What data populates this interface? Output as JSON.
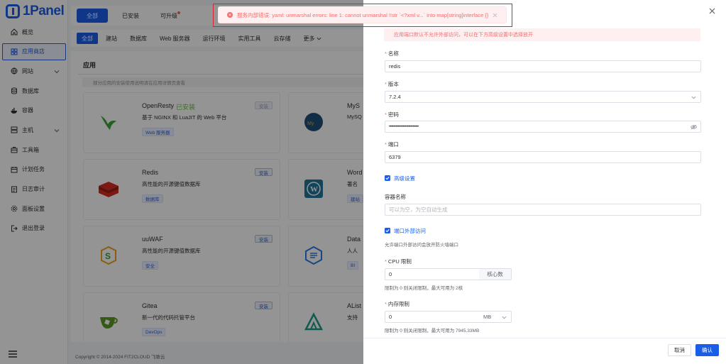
{
  "brand": {
    "name": "1Panel",
    "color": "#1a5ee8"
  },
  "sidebar": {
    "items": [
      {
        "label": "概览",
        "icon": "home-icon"
      },
      {
        "label": "应用商店",
        "icon": "grid-icon",
        "active": true
      },
      {
        "label": "网站",
        "icon": "globe-icon",
        "chevron": true
      },
      {
        "label": "数据库",
        "icon": "database-icon"
      },
      {
        "label": "容器",
        "icon": "docker-icon"
      },
      {
        "label": "主机",
        "icon": "host-icon",
        "chevron": true
      },
      {
        "label": "工具箱",
        "icon": "toolbox-icon"
      },
      {
        "label": "计划任务",
        "icon": "calendar-icon"
      },
      {
        "label": "日志审计",
        "icon": "log-icon"
      },
      {
        "label": "面板设置",
        "icon": "settings-icon"
      },
      {
        "label": "退出登录",
        "icon": "logout-icon"
      }
    ]
  },
  "topbar": {
    "tabs": [
      "全部",
      "已安装",
      "可升级"
    ]
  },
  "tagbar": {
    "tags": [
      "全部",
      "建站",
      "数据库",
      "Web 服务器",
      "运行环境",
      "实用工具",
      "云存储",
      "更多"
    ]
  },
  "panel": {
    "title": "应用",
    "notice": "部分应用的安装使用说明请在应用详情页查看",
    "cards": [
      {
        "name": "OpenResty",
        "installed_text": "已安装",
        "desc": "基于 NGINX 和 LuaJIT 的 Web 平台",
        "tag": "Web 服务器",
        "button": "安装",
        "icon": "openresty-icon"
      },
      {
        "name": "MyS",
        "desc": "MySQ",
        "button": "",
        "icon": "mysql-icon"
      },
      {
        "name": "Redis",
        "desc": "高性能的开源键值数据库",
        "tag": "数据库",
        "button": "安装",
        "icon": "redis-icon"
      },
      {
        "name": "Word",
        "desc": "著名",
        "tag": "建站",
        "button": "",
        "icon": "wordpress-icon"
      },
      {
        "name": "uuWAF",
        "desc": "高性能的开源键值数据库",
        "tag": "安全",
        "button": "安装",
        "icon": "uuwaf-icon"
      },
      {
        "name": "Data",
        "desc": "人人",
        "tag": "BI",
        "button": "",
        "icon": "dataease-icon"
      },
      {
        "name": "Gitea",
        "desc": "新一代的代码托管平台",
        "tag": "DevOps",
        "button": "安装",
        "icon": "gitea-icon"
      },
      {
        "name": "AList",
        "desc": "支持",
        "tag": "",
        "button": "",
        "icon": "alist-icon"
      }
    ]
  },
  "footer": {
    "copyright": "Copyright © 2014-2024 FIT2CLOUD 飞致云"
  },
  "error_toast": {
    "message": "服务内部错误: yaml: unmarshal errors: line 1: cannot unmarshal !!str `<?xml v...` into map[string]interface {}"
  },
  "drawer": {
    "warning": "应用端口默认不允许外部访问，可以在下方高级设置中选择放开",
    "fields": {
      "name": {
        "label": "名称",
        "value": "redis"
      },
      "version": {
        "label": "版本",
        "value": "7.2.4"
      },
      "password": {
        "label": "密码",
        "value": "••••••••••••••••••••••••••"
      },
      "port": {
        "label": "端口",
        "value": "6379"
      },
      "advanced": {
        "label": "高级设置"
      },
      "container_name": {
        "label": "容器名称",
        "placeholder": "可以为空，为空自动生成"
      },
      "external_access": {
        "label": "端口外部访问",
        "hint": "允许端口外部访问会放开防火墙端口"
      },
      "cpu": {
        "label": "CPU 限制",
        "value": "0",
        "suffix": "核心数",
        "hint": "限制为 0 则关闭限制，最大可用为 2核"
      },
      "memory": {
        "label": "内存限制",
        "value": "0",
        "unit": "MB",
        "hint": "限制为 0 则关闭限制，最大可用为 7945.33MB"
      }
    },
    "buttons": {
      "cancel": "取消",
      "confirm": "确认"
    }
  }
}
